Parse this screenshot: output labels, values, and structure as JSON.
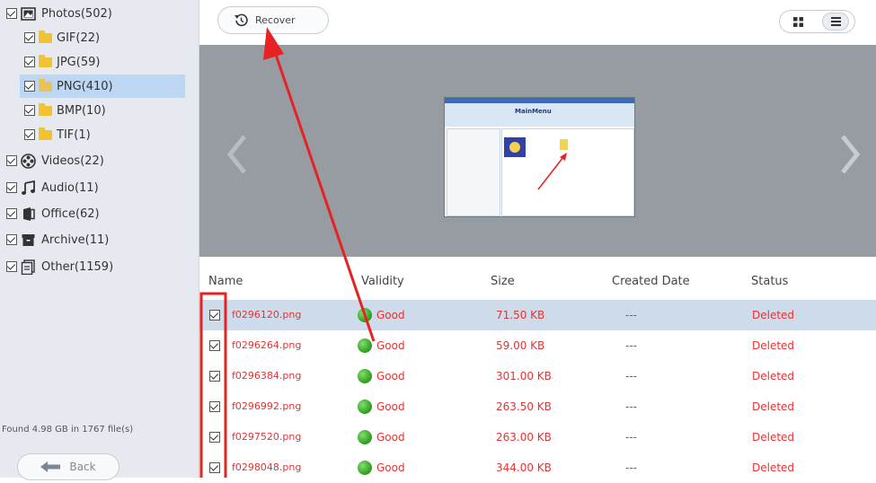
{
  "sidebar": {
    "items": [
      {
        "label": "Photos(502)",
        "icon": "photos-icon",
        "level": 0,
        "selected": false
      },
      {
        "label": "GIF(22)",
        "icon": "folder-icon",
        "level": 1,
        "selected": false
      },
      {
        "label": "JPG(59)",
        "icon": "folder-icon",
        "level": 1,
        "selected": false
      },
      {
        "label": "PNG(410)",
        "icon": "folder-icon",
        "level": 1,
        "selected": true
      },
      {
        "label": "BMP(10)",
        "icon": "folder-icon",
        "level": 1,
        "selected": false
      },
      {
        "label": "TIF(1)",
        "icon": "folder-icon",
        "level": 1,
        "selected": false
      },
      {
        "label": "Videos(22)",
        "icon": "film-reel-icon",
        "level": 0,
        "selected": false
      },
      {
        "label": "Audio(11)",
        "icon": "music-note-icon",
        "level": 0,
        "selected": false
      },
      {
        "label": "Office(62)",
        "icon": "office-icon",
        "level": 0,
        "selected": false
      },
      {
        "label": "Archive(11)",
        "icon": "archive-icon",
        "level": 0,
        "selected": false
      },
      {
        "label": "Other(1159)",
        "icon": "other-files-icon",
        "level": 0,
        "selected": false
      }
    ],
    "found_text": "Found 4.98 GB in 1767 file(s)",
    "back_label": "Back"
  },
  "toolbar": {
    "recover_label": "Recover"
  },
  "preview": {
    "thumb_brand": "MainMenu"
  },
  "table": {
    "headers": {
      "name": "Name",
      "validity": "Validity",
      "size": "Size",
      "created": "Created Date",
      "status": "Status"
    },
    "rows": [
      {
        "name": "f0296120.png",
        "validity": "Good",
        "size": "71.50 KB",
        "created": "---",
        "status": "Deleted"
      },
      {
        "name": "f0296264.png",
        "validity": "Good",
        "size": "59.00 KB",
        "created": "---",
        "status": "Deleted"
      },
      {
        "name": "f0296384.png",
        "validity": "Good",
        "size": "301.00 KB",
        "created": "---",
        "status": "Deleted"
      },
      {
        "name": "f0296992.png",
        "validity": "Good",
        "size": "263.50 KB",
        "created": "---",
        "status": "Deleted"
      },
      {
        "name": "f0297520.png",
        "validity": "Good",
        "size": "263.00 KB",
        "created": "---",
        "status": "Deleted"
      },
      {
        "name": "f0298048.png",
        "validity": "Good",
        "size": "344.00 KB",
        "created": "---",
        "status": "Deleted"
      }
    ]
  },
  "colors": {
    "sidebar_bg": "#e6eaf0",
    "selected_bg": "#bcd6f3",
    "row_highlight": "#cddbea",
    "preview_bg": "#979ca3",
    "deleted_text": "#e53333",
    "annotation": "#e62222"
  }
}
